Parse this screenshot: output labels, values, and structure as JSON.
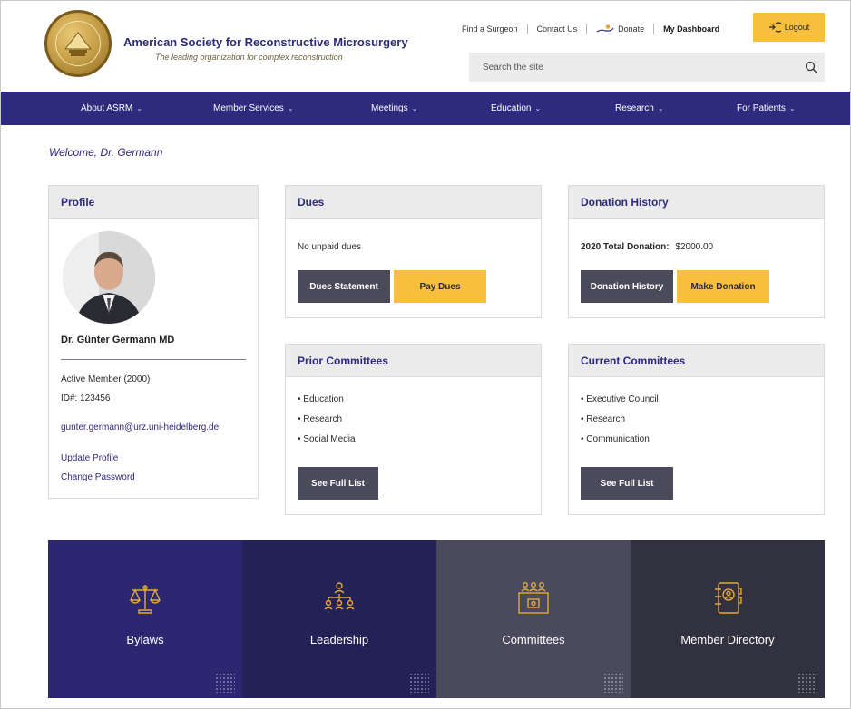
{
  "header": {
    "org_name": "American Society for Reconstructive Microsurgery",
    "tagline": "The leading organization for complex reconstruction",
    "top_links": {
      "find_surgeon": "Find a Surgeon",
      "contact": "Contact Us",
      "donate": "Donate",
      "dashboard": "My Dashboard"
    },
    "logout_label": "Logout",
    "search_placeholder": "Search the site"
  },
  "nav": {
    "items": [
      {
        "label": "About ASRM"
      },
      {
        "label": "Member Services"
      },
      {
        "label": "Meetings"
      },
      {
        "label": "Education"
      },
      {
        "label": "Research"
      },
      {
        "label": "For Patients"
      }
    ]
  },
  "welcome": "Welcome, Dr. Germann",
  "profile": {
    "title": "Profile",
    "name": "Dr. Günter Germann MD",
    "membership": "Active Member (2000)",
    "id": "ID#: 123456",
    "email": "gunter.germann@urz.uni-heidelberg.de",
    "update_link": "Update Profile",
    "password_link": "Change Password"
  },
  "dues": {
    "title": "Dues",
    "status": "No unpaid dues",
    "statement_button": "Dues Statement",
    "pay_button": "Pay Dues"
  },
  "donation": {
    "title": "Donation History",
    "total_label": "2020 Total Donation:",
    "total_value": "$2000.00",
    "history_button": "Donation History",
    "make_button": "Make Donation"
  },
  "prior_committees": {
    "title": "Prior Committees",
    "items": [
      "Education",
      "Research",
      "Social Media"
    ],
    "button": "See Full List"
  },
  "current_committees": {
    "title": "Current Committees",
    "items": [
      "Executive Council",
      "Research",
      "Communication"
    ],
    "button": "See Full List"
  },
  "tiles": [
    {
      "label": "Bylaws",
      "icon": "scales-icon",
      "color": "#2b2770"
    },
    {
      "label": "Leadership",
      "icon": "org-chart-icon",
      "color": "#242156"
    },
    {
      "label": "Committees",
      "icon": "committee-icon",
      "color": "#4b4a5c"
    },
    {
      "label": "Member Directory",
      "icon": "address-book-icon",
      "color": "#32313f"
    }
  ],
  "colors": {
    "brand_purple": "#2e2a7d",
    "accent_yellow": "#f7bf3b",
    "button_dark": "#4a4a5a",
    "icon_gold": "#e0a93a"
  }
}
